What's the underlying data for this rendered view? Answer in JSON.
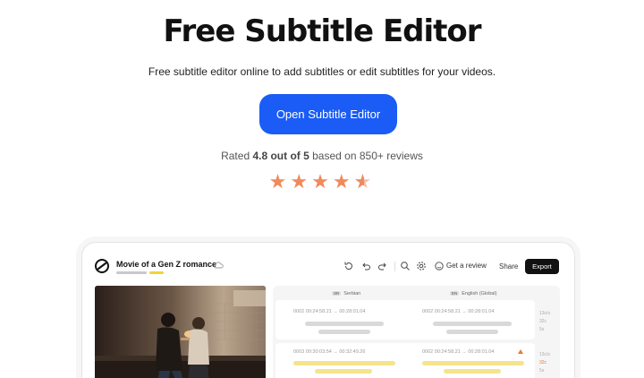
{
  "hero": {
    "title": "Free Subtitle Editor",
    "subtitle": "Free subtitle editor online to add subtitles or edit subtitles for your videos.",
    "cta_label": "Open Subtitle Editor",
    "rating_prefix": "Rated ",
    "rating_value": "4.8 out of 5",
    "rating_suffix": " based on 850+ reviews",
    "stars": 4.5,
    "star_color": "#ef8a5c",
    "cta_color": "#1a5cf5"
  },
  "editor": {
    "project_title": "Movie of a Gen Z romance",
    "toolbar": {
      "get_review": "Get a review",
      "share": "Share",
      "export": "Export"
    },
    "columns": [
      {
        "tag": "SR",
        "name": "Serbian"
      },
      {
        "tag": "EN",
        "name": "English (Global)"
      }
    ],
    "rows": [
      {
        "left_ts": "0002  00:24:58.21 → 00:28:01.04",
        "right_ts": "0002  00:24:58.21 → 00:28:01.04",
        "meta": [
          "13c/s",
          "32c",
          "5s"
        ],
        "highlight": false
      },
      {
        "left_ts": "0003  00:30:03.54 → 00:32:49.26",
        "right_ts": "0002  00:24:58.21 → 00:28:01.04",
        "meta": [
          "13c/s",
          "32c",
          "5s"
        ],
        "highlight": true
      }
    ]
  }
}
